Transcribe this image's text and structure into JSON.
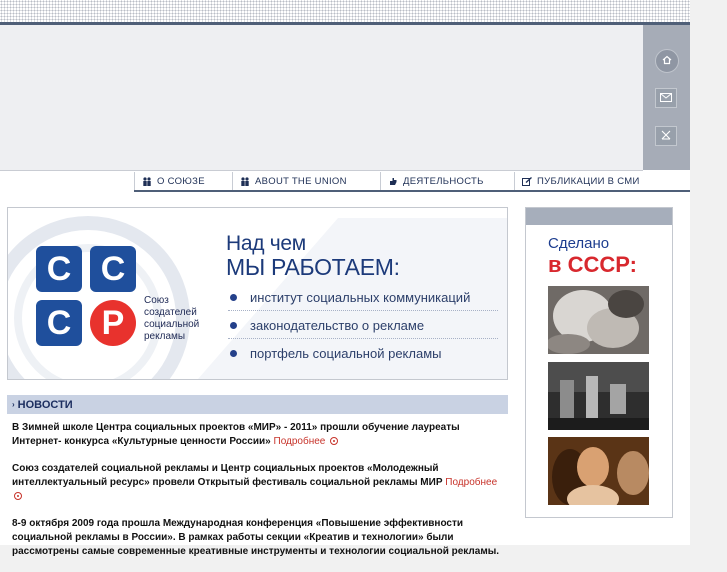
{
  "nav": {
    "items": [
      {
        "label": "О союзе",
        "icon": "people-icon"
      },
      {
        "label": "About the union",
        "icon": "people-icon"
      },
      {
        "label": "Деятельность",
        "icon": "hand-icon"
      },
      {
        "label": "Публикации в СМИ",
        "icon": "edit-icon"
      }
    ]
  },
  "side_buttons": [
    "home-icon",
    "mail-icon",
    "sitemap-icon"
  ],
  "banner": {
    "logo_letters": [
      "С",
      "С",
      "С",
      "Р"
    ],
    "logo_text": "Союз создателей социальной рекламы",
    "title_line1": "Над чем",
    "title_line2": "МЫ РАБОТАЕМ:",
    "items": [
      "институт социальных коммуникаций",
      "законодательство о рекламе",
      "портфель социальной рекламы"
    ]
  },
  "news": {
    "header": "НОВОСТИ",
    "more_label": "Подробнее",
    "items": [
      {
        "text": "В Зимней школе Центра социальных проектов «МИР» - 2011» прошли обучение лауреаты Интернет- конкурса «Культурные ценности России»"
      },
      {
        "text": "Союз создателей социальной рекламы и Центр социальных проектов «Молодежный интеллектуальный ресурс» провели Открытый фестиваль социальной рекламы МИР"
      },
      {
        "text": "8-9 октября 2009 года прошла Международная конференция «Повышение эффективности социальной рекламы в России». В рамках работы секции «Креатив и технологии» были рассмотрены самые современные креативные инструменты и технологии социальной рекламы."
      }
    ]
  },
  "made_in_ussr": {
    "line1": "Сделано",
    "line2": "в СССР:"
  },
  "colors": {
    "brand_blue": "#1f4f9c",
    "brand_red": "#e8322d",
    "link_red": "#c7332a",
    "nav_text": "#1e2f55",
    "dark_line": "#4f5f78"
  }
}
